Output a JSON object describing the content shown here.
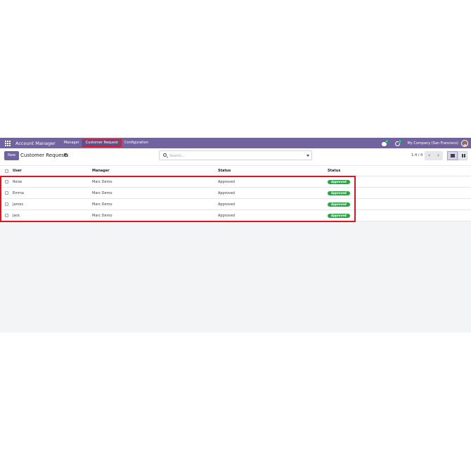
{
  "navbar": {
    "app_name": "Account Manager",
    "menu": [
      "Manager",
      "Customer Request",
      "Configuration"
    ],
    "chat_badge": "4",
    "activity_badge": "1",
    "company": "My Company (San Francisco)",
    "bg_color": "#71639e"
  },
  "control": {
    "new_label": "New",
    "title": "Customer Requests",
    "search_placeholder": "Search...",
    "pager": "1-4 / 4",
    "prev": "‹",
    "next": "›"
  },
  "table": {
    "headers": [
      "User",
      "Manager",
      "Status",
      "Status"
    ],
    "rows": [
      {
        "user": "Roise",
        "manager": "Marc Demo",
        "status": "Approved",
        "badge": "Approved"
      },
      {
        "user": "Emma",
        "manager": "Marc Demo",
        "status": "Approved",
        "badge": "Approved"
      },
      {
        "user": "James",
        "manager": "Marc Demo",
        "status": "Approved",
        "badge": "Approved"
      },
      {
        "user": "Jack",
        "manager": "Marc Demo",
        "status": "Approved",
        "badge": "Approved"
      }
    ],
    "badge_color": "#28a745"
  },
  "annotation_color": "#e3131c"
}
